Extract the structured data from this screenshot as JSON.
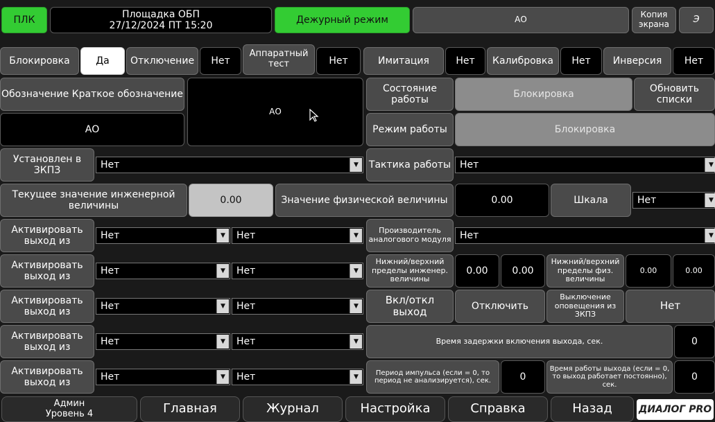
{
  "header": {
    "plc": "ПЛК",
    "site": "Площадка ОБП",
    "datetime": "27/12/2024 ПТ 15:20",
    "mode": "Дежурный режим",
    "object": "АО",
    "copy_screen": "Копия экрана",
    "e": "Э"
  },
  "flags": [
    {
      "label": "Блокировка",
      "value": "Да"
    },
    {
      "label": "Отключение",
      "value": "Нет"
    },
    {
      "label": "Аппаратный тест",
      "value": "Нет"
    },
    {
      "label": "Имитация",
      "value": "Нет"
    },
    {
      "label": "Калибровка",
      "value": "Нет"
    },
    {
      "label": "Инверсия",
      "value": "Нет"
    }
  ],
  "designation": {
    "label": "Обозначение Краткое обозначение",
    "full": "АО",
    "short": "АО"
  },
  "state": {
    "work_state_label": "Состояние работы",
    "work_state_value": "Блокировка",
    "refresh": "Обновить списки",
    "work_mode_label": "Режим работы",
    "work_mode_value": "Блокировка"
  },
  "zkpz": {
    "label": "Установлен в ЗКПЗ",
    "value": "Нет"
  },
  "tactic": {
    "label": "Тактика работы",
    "value": "Нет"
  },
  "engineering": {
    "label": "Текущее значение инженерной величины",
    "value": "0.00"
  },
  "physical": {
    "label": "Значение физической величины",
    "value": "0.00"
  },
  "scale": {
    "label": "Шкала",
    "value": "Нет"
  },
  "activate_rows": [
    {
      "label": "Активировать выход из",
      "a": "Нет",
      "b": "Нет"
    },
    {
      "label": "Активировать выход из",
      "a": "Нет",
      "b": "Нет"
    },
    {
      "label": "Активировать выход из",
      "a": "Нет",
      "b": "Нет"
    },
    {
      "label": "Активировать выход из",
      "a": "Нет",
      "b": "Нет"
    },
    {
      "label": "Активировать выход из",
      "a": "Нет",
      "b": "Нет"
    }
  ],
  "manufacturer": {
    "label": "Производитель аналогового модуля",
    "value": "Нет"
  },
  "eng_limits": {
    "label": "Нижний/верхний пределы инженер. величины",
    "low": "0.00",
    "high": "0.00"
  },
  "phys_limits": {
    "label": "Нижний/верхний пределы физ. величины",
    "low": "0.00",
    "high": "0.00"
  },
  "onoff": {
    "label": "Вкл/откл выход",
    "button": "Отключить"
  },
  "alert": {
    "label": "Выключение оповещения из ЗКПЗ",
    "value": "Нет"
  },
  "delay": {
    "label": "Время задержки включения выхода, сек.",
    "value": "0"
  },
  "pulse": {
    "label": "Период импульса (если = 0, то период не анализируется), сек.",
    "value": "0"
  },
  "runtime": {
    "label": "Время работы выхода (если = 0, то выход работает постоянно), сек.",
    "value": "0"
  },
  "footer": {
    "admin": "Админ",
    "level": "Уровень 4",
    "main": "Главная",
    "journal": "Журнал",
    "settings": "Настройка",
    "help": "Справка",
    "back": "Назад",
    "logo": "ДИАЛОГ PRO"
  }
}
